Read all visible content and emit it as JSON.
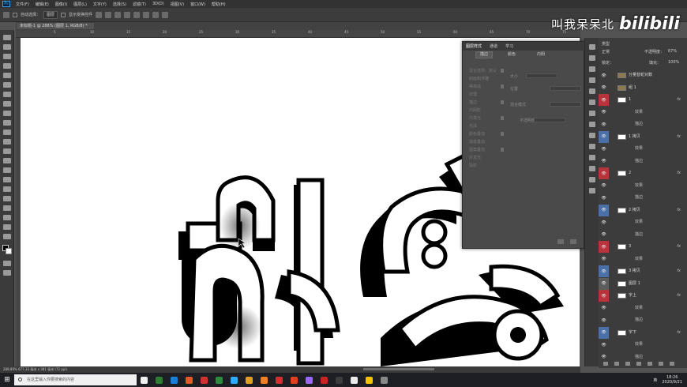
{
  "app": {
    "logo": "Ps",
    "menu": [
      "文件(F)",
      "编辑(E)",
      "图像(I)",
      "图层(L)",
      "文字(Y)",
      "选择(S)",
      "滤镜(T)",
      "3D(D)",
      "视图(V)",
      "窗口(W)",
      "帮助(H)"
    ]
  },
  "options": {
    "auto_select_label": "自动选择：",
    "auto_select_value": "图层",
    "show_transform_label": "显示变换控件"
  },
  "document": {
    "tab_title": "未标题-1 @ 288% (图层 1, RGB/8) *",
    "ruler_ticks": [
      "5",
      "10",
      "15",
      "20",
      "25",
      "30",
      "35",
      "40",
      "45",
      "50",
      "55",
      "60",
      "65",
      "70",
      "75"
    ],
    "status": "288.89%    677.33 毫米 x 381 毫米 (72 ppi)"
  },
  "watermark": {
    "text": "叫我呆呆北",
    "logo": "bilibili"
  },
  "float_panel": {
    "tabs": [
      "图层样式",
      "通道",
      "学习"
    ],
    "buttons": [
      "描边",
      "颜色",
      "内阴"
    ],
    "items": [
      "混合选项：默认",
      "斜面和浮雕",
      "等高线",
      "纹理",
      "描边",
      "内阴影",
      "内发光",
      "光泽",
      "颜色叠加",
      "渐变叠加",
      "图案叠加",
      "外发光",
      "投影"
    ],
    "field_labels": [
      "大小",
      "位置",
      "混合模式",
      "不透明度"
    ]
  },
  "layers": {
    "kind_label": "类型",
    "blend_mode": "正常",
    "opacity_label": "不透明度：",
    "opacity_value": "67%",
    "lock_label": "锁定：",
    "fill_label": "填充：",
    "fill_value": "100%",
    "rows": [
      {
        "type": "group",
        "name": "分量替蛇对数",
        "color": "#3c3c3c"
      },
      {
        "type": "group",
        "name": "组 1",
        "color": "#3c3c3c"
      },
      {
        "type": "layer",
        "name": "1",
        "color": "#b8343c",
        "fx": "fx"
      },
      {
        "type": "sub",
        "name": "效果",
        "color": "#3c3c3c"
      },
      {
        "type": "sub",
        "name": "描边",
        "color": "#3c3c3c"
      },
      {
        "type": "layer",
        "name": "1 拷贝",
        "color": "#4b6fa8",
        "fx": "fx"
      },
      {
        "type": "sub",
        "name": "效果",
        "color": "#3c3c3c"
      },
      {
        "type": "sub",
        "name": "描边",
        "color": "#3c3c3c"
      },
      {
        "type": "layer",
        "name": "2",
        "color": "#b8343c",
        "fx": "fx"
      },
      {
        "type": "sub",
        "name": "效果",
        "color": "#3c3c3c"
      },
      {
        "type": "sub",
        "name": "描边",
        "color": "#3c3c3c"
      },
      {
        "type": "layer",
        "name": "2 拷贝",
        "color": "#4b6fa8",
        "fx": "fx"
      },
      {
        "type": "sub",
        "name": "效果",
        "color": "#3c3c3c"
      },
      {
        "type": "sub",
        "name": "描边",
        "color": "#3c3c3c"
      },
      {
        "type": "layer",
        "name": "3",
        "color": "#b8343c",
        "fx": "fx"
      },
      {
        "type": "sub",
        "name": "效果",
        "color": "#3c3c3c"
      },
      {
        "type": "layer",
        "name": "3 拷贝",
        "color": "#4b6fa8",
        "fx": "fx"
      },
      {
        "type": "layer",
        "name": "图层 1",
        "color": "#5c5c5c",
        "fx": ""
      },
      {
        "type": "layer",
        "name": "字上",
        "color": "#b8343c",
        "fx": "fx"
      },
      {
        "type": "sub",
        "name": "效果",
        "color": "#3c3c3c"
      },
      {
        "type": "sub",
        "name": "描边",
        "color": "#3c3c3c"
      },
      {
        "type": "layer",
        "name": "字下",
        "color": "#4b6fa8",
        "fx": "fx"
      },
      {
        "type": "sub",
        "name": "效果",
        "color": "#3c3c3c"
      },
      {
        "type": "sub",
        "name": "描边",
        "color": "#3c3c3c"
      }
    ]
  },
  "taskbar": {
    "search_placeholder": "在这里输入你要搜索的内容",
    "apps": [
      "#f0f0f0",
      "#2d7d32",
      "#1a7fd6",
      "#e35a2a",
      "#d0302f",
      "#2e8b3e",
      "#31a8ff",
      "#e0a020",
      "#f08020",
      "#d03030",
      "#e04020",
      "#9966ff",
      "#cc2222",
      "#3c3c3c",
      "#eaeaea",
      "#f5c400",
      "#888888"
    ],
    "ime": "英",
    "time": "18:26",
    "date": "2020/9/21"
  }
}
